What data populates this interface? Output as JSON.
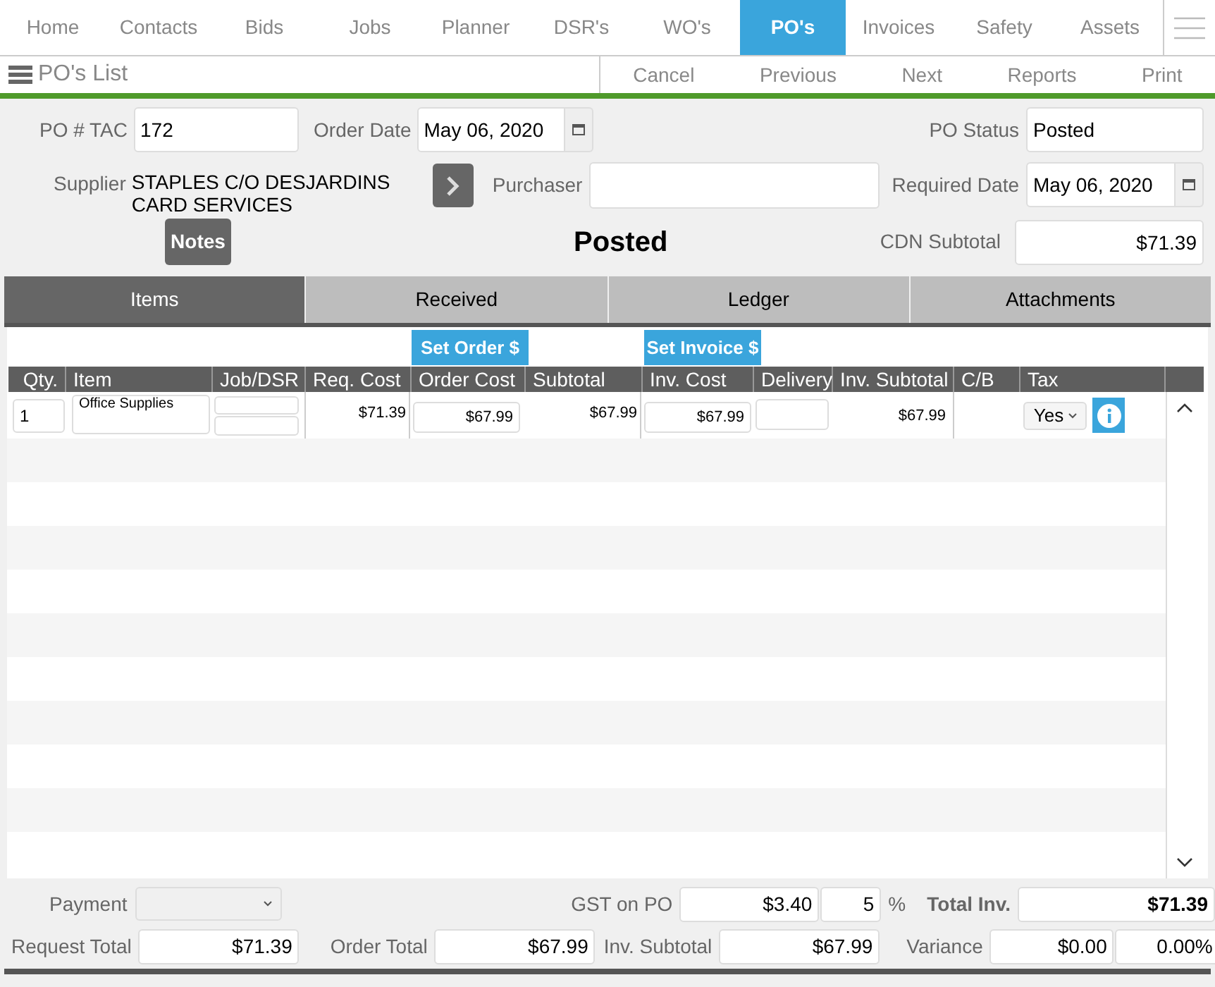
{
  "nav": {
    "tabs": [
      {
        "label": "Home",
        "selected": false
      },
      {
        "label": "Contacts",
        "selected": false
      },
      {
        "label": "Bids",
        "selected": false
      },
      {
        "label": "Jobs",
        "selected": false
      },
      {
        "label": "Planner",
        "selected": false
      },
      {
        "label": "DSR's",
        "selected": false
      },
      {
        "label": "WO's",
        "selected": false
      },
      {
        "label": "PO's",
        "selected": true
      },
      {
        "label": "Invoices",
        "selected": false
      },
      {
        "label": "Safety",
        "selected": false
      },
      {
        "label": "Assets",
        "selected": false
      }
    ]
  },
  "toolbar": {
    "title": "PO's List",
    "actions": [
      "Cancel",
      "Previous",
      "Next",
      "Reports",
      "Print"
    ]
  },
  "form": {
    "po_tac": {
      "label": "PO # TAC",
      "value": "172"
    },
    "order_date": {
      "label": "Order Date",
      "value": "May 06, 2020"
    },
    "po_status": {
      "label": "PO Status",
      "value": "Posted"
    },
    "supplier": {
      "label": "Supplier",
      "value": "STAPLES C/O DESJARDINS CARD SERVICES"
    },
    "purchaser": {
      "label": "Purchaser"
    },
    "required_date": {
      "label": "Required Date",
      "value": "May 06, 2020"
    },
    "notes_button": "Notes",
    "status_banner": "Posted",
    "cdn_subtotal": {
      "label": "CDN Subtotal",
      "value": "$71.39"
    }
  },
  "tabs": [
    {
      "label": "Items",
      "selected": true
    },
    {
      "label": "Received",
      "selected": false
    },
    {
      "label": "Ledger",
      "selected": false
    },
    {
      "label": "Attachments",
      "selected": false
    }
  ],
  "table": {
    "set_order_button": "Set Order $",
    "set_invoice_button": "Set Invoice $",
    "columns": [
      "Qty.",
      "Item",
      "Job/DSR",
      "Req. Cost",
      "Order Cost",
      "Subtotal",
      "Inv. Cost",
      "Delivery",
      "Inv. Subtotal",
      "C/B",
      "Tax"
    ],
    "rows": [
      {
        "qty": "1",
        "item": "Office Supplies",
        "req_cost": "$71.39",
        "order_cost": "$67.99",
        "subtotal": "$67.99",
        "inv_cost": "$67.99",
        "inv_subtotal": "$67.99",
        "tax": "Yes"
      }
    ]
  },
  "footer": {
    "payment": {
      "label": "Payment"
    },
    "gst": {
      "label": "GST on PO",
      "value": "$3.40",
      "rate": "5",
      "unit": "%"
    },
    "total_inv": {
      "label": "Total Inv.",
      "value": "$71.39"
    },
    "request_total": {
      "label": "Request Total",
      "value": "$71.39"
    },
    "order_total": {
      "label": "Order Total",
      "value": "$67.99"
    },
    "inv_subtotal": {
      "label": "Inv. Subtotal",
      "value": "$67.99"
    },
    "variance": {
      "label": "Variance",
      "value": "$0.00",
      "percent": "0.00%"
    }
  }
}
